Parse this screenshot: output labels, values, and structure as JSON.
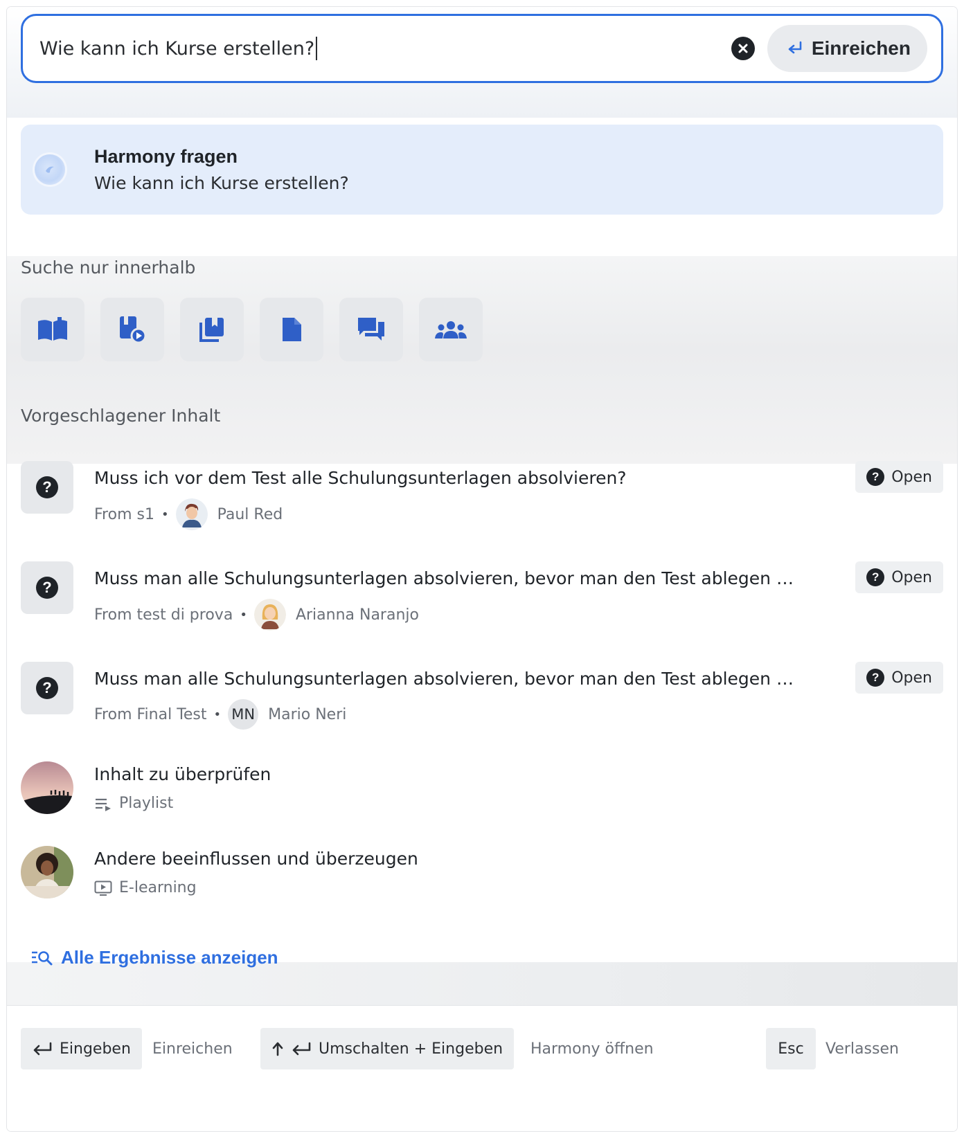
{
  "search": {
    "value": "Wie kann ich Kurse erstellen?",
    "submit_label": "Einreichen"
  },
  "harmony": {
    "title": "Harmony fragen",
    "query": "Wie kann ich Kurse erstellen?"
  },
  "filters": {
    "label": "Suche nur innerhalb",
    "icons": [
      "book-open-icon",
      "course-play-icon",
      "library-icon",
      "document-icon",
      "discussion-icon",
      "group-icon"
    ]
  },
  "suggested": {
    "label": "Vorgeschlagener Inhalt",
    "questions": [
      {
        "title": "Muss ich vor dem Test alle Schulungsunterlagen absolvieren?",
        "source": "From s1",
        "author": "Paul Red",
        "status": "Open"
      },
      {
        "title": "Muss man alle Schulungsunterlagen absolvieren, bevor man den Test ablegen k...",
        "source": "From test di prova",
        "author": "Arianna Naranjo",
        "status": "Open"
      },
      {
        "title": "Muss man alle Schulungsunterlagen absolvieren, bevor man den Test ablegen k...",
        "source": "From Final Test",
        "author": "Mario Neri",
        "initials": "MN",
        "status": "Open"
      }
    ],
    "content": [
      {
        "title": "Inhalt zu überprüfen",
        "type": "Playlist"
      },
      {
        "title": "Andere beeinflussen und überzeugen",
        "type": "E-learning"
      }
    ]
  },
  "all_results_label": "Alle Ergebnisse anzeigen",
  "footer": {
    "enter_key": "Eingeben",
    "enter_hint": "Einreichen",
    "shift_enter_key": "Umschalten + Eingeben",
    "shift_enter_hint": "Harmony öffnen",
    "esc_key": "Esc",
    "esc_hint": "Verlassen"
  },
  "colors": {
    "accent": "#2f6fe0",
    "harmony_bg": "#e4edfb"
  }
}
